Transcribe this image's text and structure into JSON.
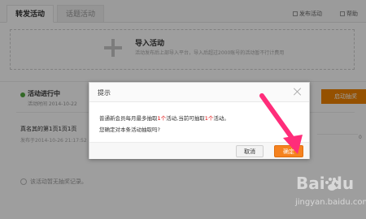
{
  "tabs": {
    "active": "转发活动",
    "inactive": "话题活动"
  },
  "toplinks": {
    "publish": "发布活动",
    "help": "帮助"
  },
  "import": {
    "title": "导入活动",
    "desc": "活动发布后上部导入平台，导入后超过2000账号的活动暂不行计费用"
  },
  "status": {
    "title": "活动进行中",
    "sub": "活动时间 2014-10-22",
    "action": "启动抽奖"
  },
  "item": {
    "title": "真名其的第1页1页1页",
    "time": "发布于2014-10-26 21:17:52"
  },
  "right_num": "0",
  "empty": "该活动暂无抽奖记录。",
  "dialog": {
    "title": "提示",
    "line1_a": "普通新会员每月最多抽取",
    "line1_b": "1个",
    "line1_c": "活动,当前可抽取",
    "line1_d": "1个",
    "line1_e": "活动。",
    "line2": "您确定对本条活动抽取吗?",
    "cancel": "取消",
    "ok": "确定"
  },
  "watermark": {
    "logo": "Bai du",
    "sub": "jingyan.baidu.com"
  }
}
